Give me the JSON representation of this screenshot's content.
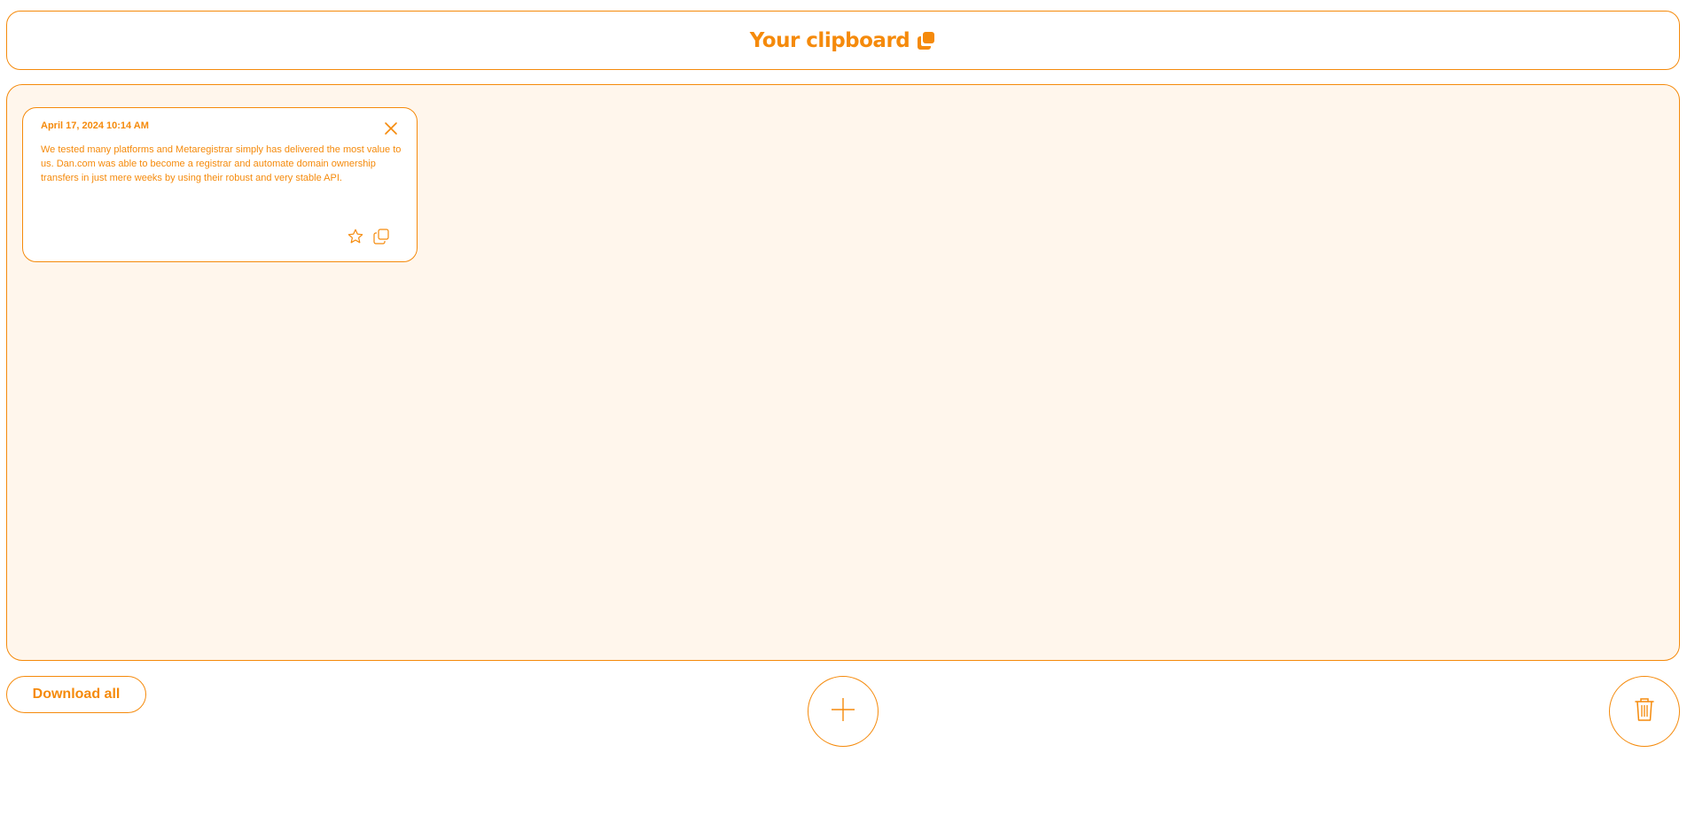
{
  "header": {
    "title": "Your clipboard",
    "title_icon": "copy-icon"
  },
  "clips": [
    {
      "date": "April 17, 2024 10:14 AM",
      "text": "We tested many platforms and Metaregistrar simply has delivered the most value to us. Dan.com was able to become a registrar and automate domain ownership transfers in just mere weeks by using their robust and very stable API.",
      "icons": [
        "close-icon",
        "star-icon",
        "copy-icon"
      ]
    }
  ],
  "footer": {
    "download_label": "Download all",
    "add_icon": "plus-icon",
    "clear_icon": "trash-icon"
  },
  "colors": {
    "accent": "#f58a0b",
    "board_background": "#fff6ec",
    "card_background": "#ffffff"
  }
}
